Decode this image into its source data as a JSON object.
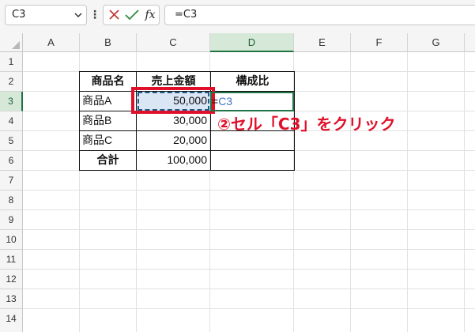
{
  "formula_bar": {
    "name_box": "C3",
    "formula": "=C3",
    "fx_label": "fx"
  },
  "columns": [
    "A",
    "B",
    "C",
    "D",
    "E",
    "F",
    "G"
  ],
  "rows": [
    "1",
    "2",
    "3",
    "4",
    "5",
    "6",
    "7",
    "8",
    "9",
    "10",
    "11",
    "12",
    "13",
    "14"
  ],
  "table": {
    "headers": [
      "商品名",
      "売上金額",
      "構成比"
    ],
    "rows": [
      {
        "name": "商品A",
        "amount": "50,000"
      },
      {
        "name": "商品B",
        "amount": "30,000"
      },
      {
        "name": "商品C",
        "amount": "20,000"
      }
    ],
    "total_label": "合計",
    "total_amount": "100,000"
  },
  "active_cell_formula": {
    "eq": "=",
    "ref": "C3"
  },
  "annotation": "②セル「C3」をクリック",
  "colors": {
    "accent_green": "#217346",
    "highlight_red": "#e0102a",
    "reference_blue": "#4472c4"
  }
}
